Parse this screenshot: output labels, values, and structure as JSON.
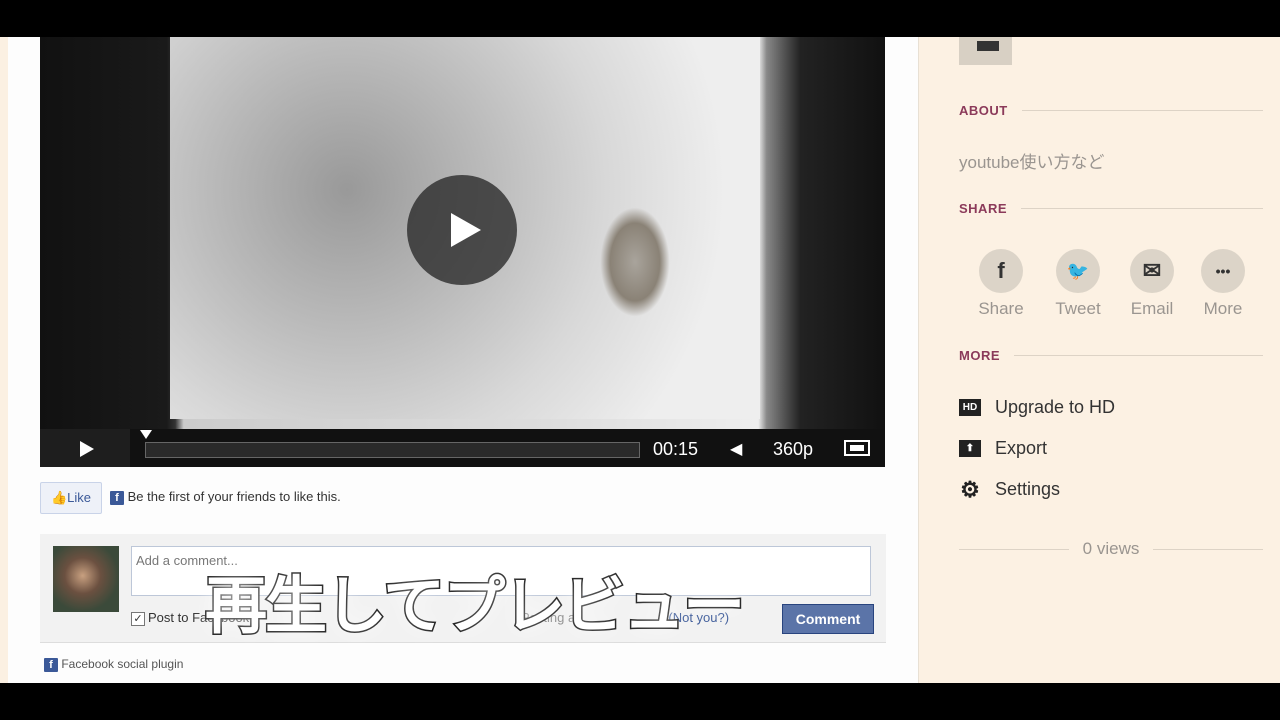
{
  "player": {
    "time": "00:15",
    "quality": "360p",
    "progress_fraction": 0.0
  },
  "facebook": {
    "like_label": "Like",
    "like_text": "Be the first of your friends to like this.",
    "comment_placeholder": "Add a comment...",
    "post_to": "Post to Facebook",
    "posting_as": "Posting as",
    "not_you": "(Not you?)",
    "comment_button": "Comment",
    "plugin_label": "Facebook social plugin",
    "icon_letter": "f"
  },
  "caption": "再生してプレビュー",
  "sidebar": {
    "about_heading": "ABOUT",
    "about_text": "youtube使い方など",
    "share_heading": "SHARE",
    "share": [
      {
        "label": "Share",
        "icon": "facebook-icon",
        "glyph": "f"
      },
      {
        "label": "Tweet",
        "icon": "twitter-icon",
        "glyph": "🐦"
      },
      {
        "label": "Email",
        "icon": "email-icon",
        "glyph": "✉"
      },
      {
        "label": "More",
        "icon": "more-icon",
        "glyph": "•••"
      }
    ],
    "more_heading": "MORE",
    "more": [
      {
        "label": "Upgrade to HD",
        "icon": "hd-icon",
        "glyph": "HD"
      },
      {
        "label": "Export",
        "icon": "export-icon",
        "glyph": "⬆"
      },
      {
        "label": "Settings",
        "icon": "gear-icon",
        "glyph": "⚙"
      }
    ],
    "views": "0 views"
  },
  "colors": {
    "sidebar_bg": "#fcf1e3",
    "heading": "#8b3a5a",
    "facebook": "#3b5998"
  }
}
